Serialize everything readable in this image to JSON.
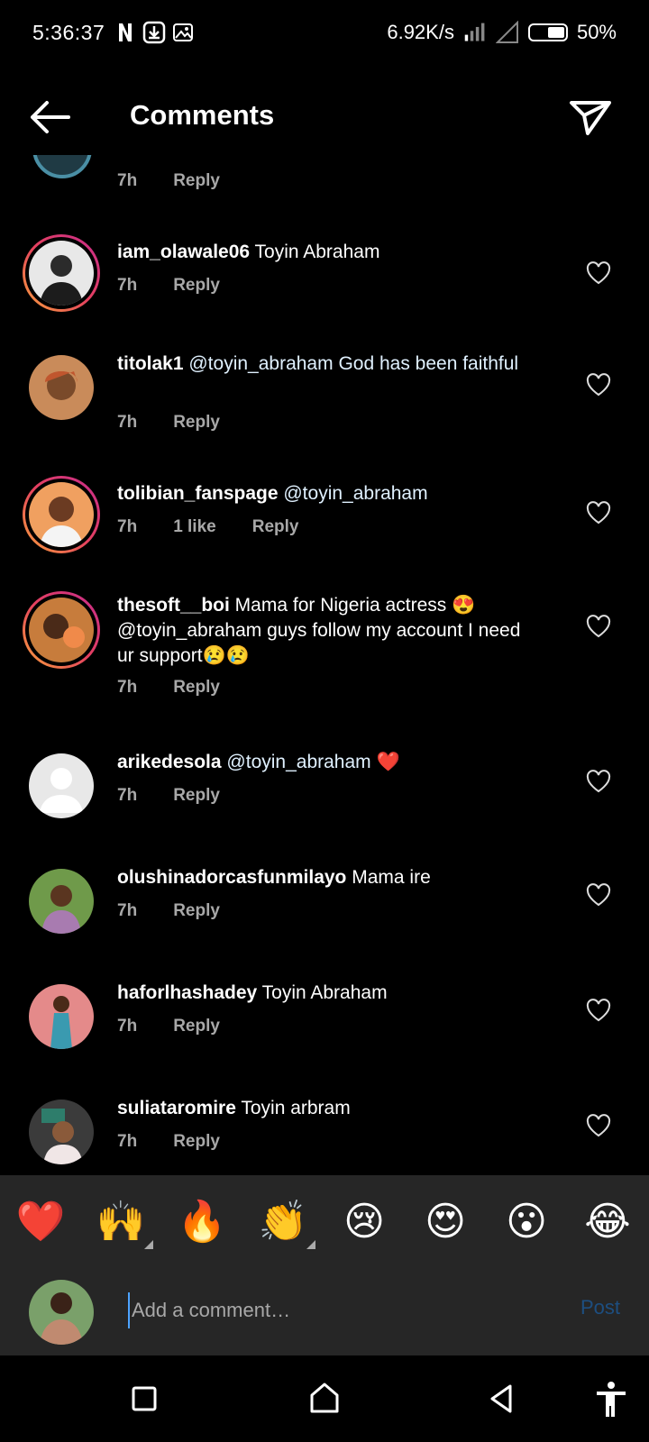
{
  "status": {
    "time": "5:36:37",
    "speed": "6.92K/s",
    "battery": "50%"
  },
  "header": {
    "title": "Comments"
  },
  "partial_comment": {
    "time": "7h",
    "reply": "Reply"
  },
  "comments": [
    {
      "user": "iam_olawale06",
      "text": " Toyin Abraham",
      "time": "7h",
      "likes": "",
      "reply": "Reply"
    },
    {
      "user": "titolak1",
      "text": " @toyin_abraham  God has been faithful",
      "time": "7h",
      "likes": "",
      "reply": "Reply"
    },
    {
      "user": "tolibian_fanspage",
      "text": " @toyin_abraham",
      "time": "7h",
      "likes": "1 like",
      "reply": "Reply"
    },
    {
      "user": "thesoft__boi",
      "text": " Mama for Nigeria actress 😍 @toyin_abraham  guys follow my account I need ur support😢😢",
      "time": "7h",
      "likes": "",
      "reply": "Reply"
    },
    {
      "user": "arikedesola",
      "text": " @toyin_abraham ❤️",
      "time": "7h",
      "likes": "",
      "reply": "Reply"
    },
    {
      "user": "olushinadorcasfunmilayo",
      "text": " Mama ire",
      "time": "7h",
      "likes": "",
      "reply": "Reply"
    },
    {
      "user": "haforlhashadey",
      "text": " Toyin Abraham",
      "time": "7h",
      "likes": "",
      "reply": "Reply"
    },
    {
      "user": "suliataromire",
      "text": " Toyin  arbram",
      "time": "7h",
      "likes": "",
      "reply": "Reply"
    }
  ],
  "emoji_bar": [
    "❤️",
    "🙌",
    "🔥",
    "👏",
    "😢",
    "😍",
    "😮",
    "😂"
  ],
  "input": {
    "placeholder": "Add a comment…",
    "post_label": "Post"
  },
  "colors": {
    "background": "#000000",
    "bar": "#262626",
    "post_disabled": "#1d4e80",
    "meta": "#a8a8a8"
  }
}
